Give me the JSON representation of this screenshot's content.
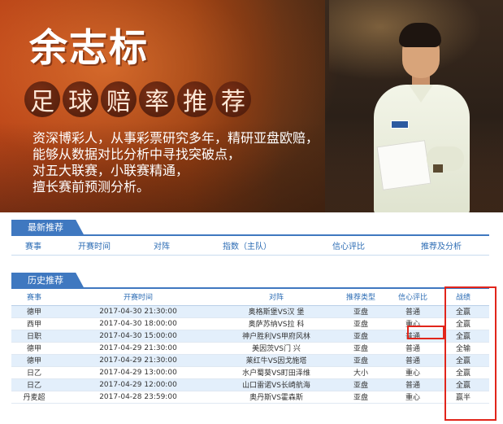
{
  "banner": {
    "title": "余志标",
    "subtitle_chars": [
      "足",
      "球",
      "赔",
      "率",
      "推",
      "荐"
    ],
    "intro_lines": [
      "资深博彩人，从事彩票研究多年，精研亚盘欧赔，",
      "能够从数据对比分析中寻找突破点，",
      "对五大联赛，小联赛精通，",
      "擅长赛前预测分析。"
    ]
  },
  "latest": {
    "tab": "最新推荐",
    "headers": [
      "赛事",
      "开赛时间",
      "对阵",
      "指数（主队）",
      "信心评比",
      "推荐及分析"
    ]
  },
  "history": {
    "tab": "历史推荐",
    "headers": [
      "赛事",
      "开赛时间",
      "对阵",
      "推荐类型",
      "信心评比",
      "战绩"
    ],
    "rows": [
      {
        "league": "德甲",
        "time": "2017-04-30 21:30:00",
        "match": "奥格斯堡VS汉 堡",
        "type": "亚盘",
        "confidence": "普通",
        "result": "全赢"
      },
      {
        "league": "西甲",
        "time": "2017-04-30 18:00:00",
        "match": "奥萨苏纳VS拉 科",
        "type": "亚盘",
        "confidence": "重心",
        "result": "全赢"
      },
      {
        "league": "日职",
        "time": "2017-04-30 15:00:00",
        "match": "神户胜利VS甲府风林",
        "type": "亚盘",
        "confidence": "普通",
        "result": "全赢"
      },
      {
        "league": "德甲",
        "time": "2017-04-29 21:30:00",
        "match": "美因茨VS门 兴",
        "type": "亚盘",
        "confidence": "普通",
        "result": "全输"
      },
      {
        "league": "德甲",
        "time": "2017-04-29 21:30:00",
        "match": "莱红牛VS因戈施塔",
        "type": "亚盘",
        "confidence": "普通",
        "result": "全赢"
      },
      {
        "league": "日乙",
        "time": "2017-04-29 13:00:00",
        "match": "水户蜀葵VS町田泽维",
        "type": "大小",
        "confidence": "重心",
        "result": "全赢"
      },
      {
        "league": "日乙",
        "time": "2017-04-29 12:00:00",
        "match": "山口雷诺VS长崎航海",
        "type": "亚盘",
        "confidence": "普通",
        "result": "全赢"
      },
      {
        "league": "丹麦超",
        "time": "2017-04-28 23:59:00",
        "match": "奥丹斯VS霍森斯",
        "type": "亚盘",
        "confidence": "重心",
        "result": "赢半"
      }
    ]
  },
  "colors": {
    "accent_blue": "#3f78c0",
    "highlight_red": "#e1251b"
  }
}
